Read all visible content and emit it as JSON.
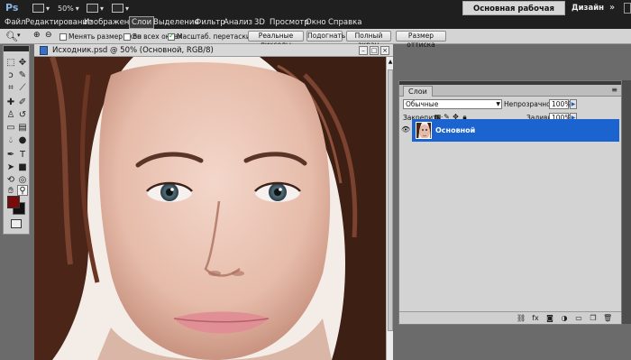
{
  "app": {
    "logo": "Ps",
    "zoom_display": "50%",
    "workspace_button": "Основная рабочая среда",
    "design_link": "Дизайн",
    "expand_glyph": "»"
  },
  "menu": {
    "items": [
      "Файл",
      "Редактирование",
      "Изображение",
      "Слои",
      "Выделение",
      "Фильтр",
      "Анализ",
      "3D",
      "Просмотр",
      "Окно",
      "Справка"
    ],
    "active_index": 3
  },
  "options": {
    "resize_windows": {
      "label": "Менять размер окон",
      "checked": false
    },
    "all_windows": {
      "label": "Во всех окнах",
      "checked": false
    },
    "scrubby_zoom": {
      "label": "Масштаб. перетаскиванием",
      "checked": true
    },
    "buttons": [
      "Реальные пикселы",
      "Подогнать",
      "Полный экран",
      "Размер оттиска"
    ]
  },
  "document": {
    "title": "Исходник.psd @ 50% (Основной, RGB/8)"
  },
  "layers_panel": {
    "tab_label": "Слои",
    "blend_mode": "Обычные",
    "opacity_label": "Непрозрачность:",
    "opacity_value": "100%",
    "lock_label": "Закрепить:",
    "fill_label": "Заливка:",
    "fill_value": "100%",
    "layers": [
      {
        "name": "Основной",
        "selected": true,
        "visible": true
      }
    ]
  },
  "colors": {
    "foreground": "#7a0b0b",
    "background": "#111111",
    "selection": "#1b63cf"
  }
}
